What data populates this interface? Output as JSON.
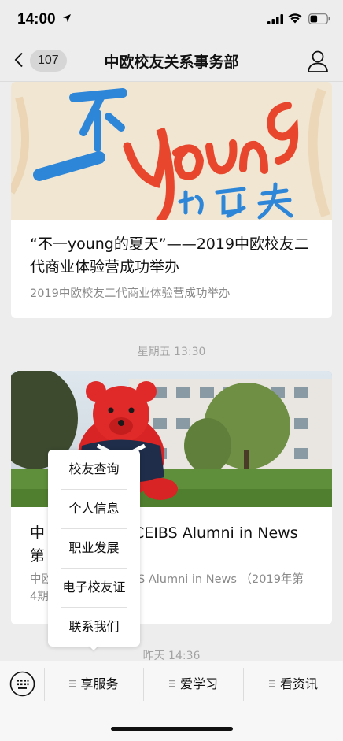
{
  "status_bar": {
    "time": "14:00",
    "icons": [
      "location-arrow-icon",
      "signal-icon",
      "wifi-icon",
      "battery-icon"
    ]
  },
  "nav": {
    "unread_count": "107",
    "title": "中欧校友关系事务部",
    "back_icon": "chevron-left-icon",
    "profile_icon": "person-icon"
  },
  "feed": {
    "article1": {
      "title": "“不一young的夏天”——2019中欧校友二代商业体验营成功举办",
      "digest": "2019中欧校友二代商业体验营成功举办"
    },
    "time1": "星期五 13:30",
    "article2": {
      "title_visible_left": "中",
      "title_visible_right": "CEIBS Alumni in News",
      "title_line2": "第",
      "digest_left": "中欧",
      "digest_right": "S Alumni in News （2019年第",
      "digest_line2": "4期"
    },
    "time2": "昨天 14:36"
  },
  "popup_menu": {
    "items": [
      "校友查询",
      "个人信息",
      "职业发展",
      "电子校友证",
      "联系我们"
    ]
  },
  "bottom_menu": {
    "keyboard_icon": "keyboard-icon",
    "tabs": [
      "享服务",
      "爱学习",
      "看资讯"
    ]
  },
  "colors": {
    "background": "#ededed",
    "card": "#ffffff",
    "secondary_text": "#8a8a8a",
    "banner_red": "#e8472d",
    "banner_blue": "#2e86d9",
    "bear_red": "#d82424"
  }
}
